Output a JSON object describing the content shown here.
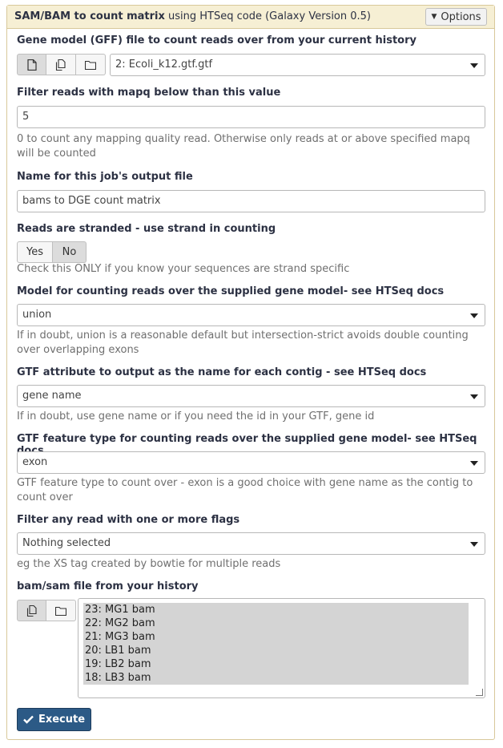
{
  "header": {
    "tool_name": "SAM/BAM to count matrix",
    "tool_desc": " using HTSeq code (Galaxy Version 0.5)",
    "options_label": "Options"
  },
  "gff": {
    "label": "Gene model (GFF) file to count reads over from your current history",
    "value": "2: Ecoli_k12.gtf.gtf"
  },
  "mapq": {
    "label": "Filter reads with mapq below than this value",
    "value": "5",
    "help": "0 to count any mapping quality read. Otherwise only reads at or above specified mapq will be counted"
  },
  "outname": {
    "label": "Name for this job's output file",
    "value": "bams to DGE count matrix"
  },
  "stranded": {
    "label": "Reads are stranded - use strand in counting",
    "yes_label": "Yes",
    "no_label": "No",
    "selected": "No",
    "help": "Check this ONLY if you know your sequences are strand specific"
  },
  "model": {
    "label": "Model for counting reads over the supplied gene model- see HTSeq docs",
    "value": "union",
    "help": "If in doubt, union is a reasonable default but intersection-strict avoids double counting over overlapping exons"
  },
  "attribute": {
    "label": "GTF attribute to output as the name for each contig - see HTSeq docs",
    "value": "gene name",
    "help": "If in doubt, use gene name or if you need the id in your GTF, gene id"
  },
  "feature": {
    "label": "GTF feature type for counting reads over the supplied gene model- see HTSeq docs",
    "value": "exon",
    "help": "GTF feature type to count over - exon is a good choice with gene name as the contig to count over"
  },
  "flags": {
    "label": "Filter any read with one or more flags",
    "value": "Nothing selected",
    "help": "eg the XS tag created by bowtie for multiple reads"
  },
  "bams": {
    "label": "bam/sam file from your history",
    "items": [
      "23: MG1 bam",
      "22: MG2 bam",
      "21: MG3 bam",
      "20: LB1 bam",
      "19: LB2 bam",
      "18: LB3 bam"
    ]
  },
  "execute_label": "Execute",
  "colors": {
    "header_bg": "#f6efd4",
    "panel_border": "#d8c89a",
    "execute_bg": "#2c5a86"
  },
  "icons": [
    "file-icon",
    "files-icon",
    "folder-icon",
    "check-icon",
    "caret-down-icon"
  ]
}
